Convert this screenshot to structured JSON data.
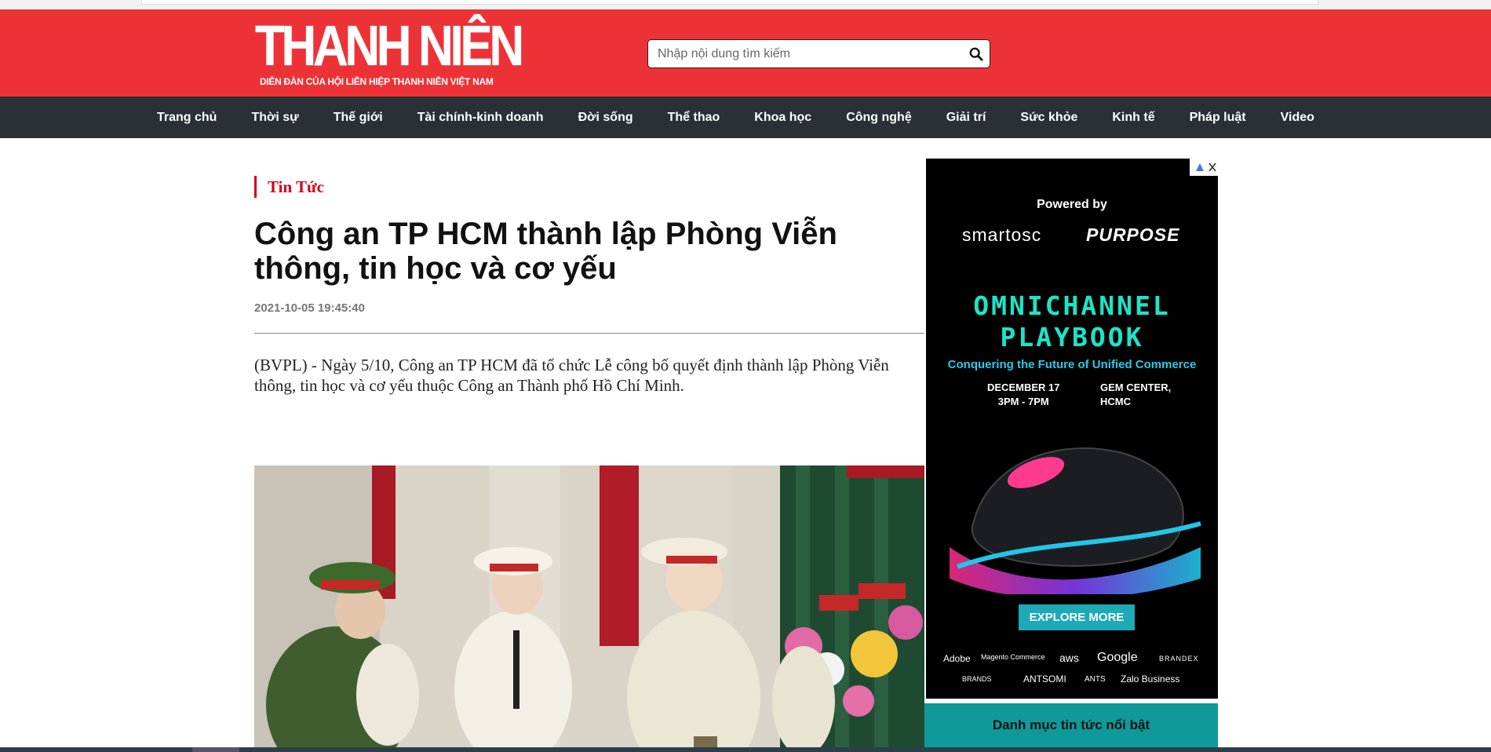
{
  "site": {
    "logo_text": "THANH NIÊN",
    "logo_tagline": "DIỄN ĐÀN CỦA HỘI LIÊN HIỆP THANH NIÊN VIỆT NAM"
  },
  "search": {
    "placeholder": "Nhập nội dung tìm kiếm",
    "icon": "search-icon"
  },
  "nav": {
    "items": [
      "Trang chủ",
      "Thời sự",
      "Thế giới",
      "Tài chính-kinh doanh",
      "Đời sống",
      "Thể thao",
      "Khoa học",
      "Công nghệ",
      "Giải trí",
      "Sức khỏe",
      "Kinh tế",
      "Pháp luật",
      "Video"
    ]
  },
  "article": {
    "category": "Tin Tức",
    "title": "Công an TP HCM thành lập Phòng Viễn thông, tin học và cơ yếu",
    "date": "2021-10-05 19:45:40",
    "sapo": "(BVPL) - Ngày 5/10, Công an TP HCM đã tổ chức Lễ công bố quyết định thành lập Phòng Viễn thông, tin học và cơ yếu thuộc Công an Thành phố Hồ Chí Minh."
  },
  "ad": {
    "powered_by": "Powered by",
    "brand_1": "smartosc",
    "brand_2": "PURPOSE",
    "headline_1": "OMNICHANNEL",
    "headline_2": "PLAYBOOK",
    "tagline": "Conquering the Future of Unified Commerce",
    "date_1": "DECEMBER 17",
    "time_1": "3PM - 7PM",
    "venue_1": "GEM CENTER,",
    "venue_2": "HCMC",
    "cta": "EXPLORE MORE",
    "partners_row1": [
      "Adobe",
      "Magento Commerce",
      "aws",
      "Google",
      "BRANDEX"
    ],
    "partners_row2": [
      "BRANDS",
      "ANTSOMI",
      "ANTS",
      "Zalo Business"
    ]
  },
  "featured": {
    "label": "Danh mục tin tức nổi bật"
  },
  "colors": {
    "header_red": "#ed3237",
    "nav_dark": "#2b2f36",
    "category_red": "#d0021b",
    "ad_teal": "#19e6c8",
    "featured_teal": "#0f999a"
  }
}
